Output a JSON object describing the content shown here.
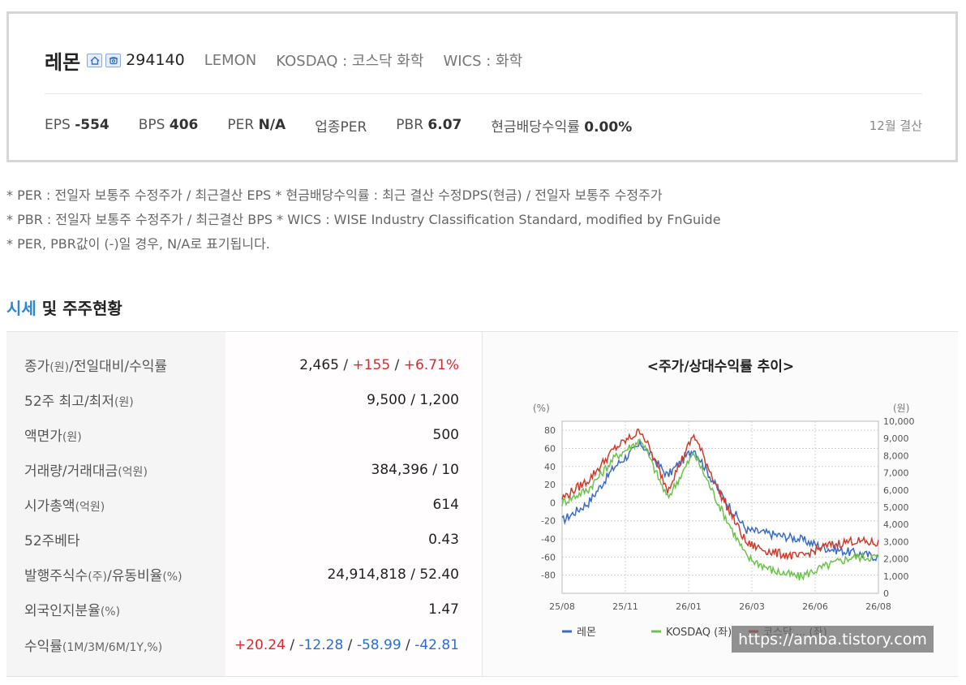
{
  "company": {
    "name": "레몬",
    "code": "294140",
    "english_name": "LEMON",
    "market": "KOSDAQ : 코스닥 화학",
    "wics": "WICS : 화학",
    "icons": [
      "home-icon",
      "phone-icon"
    ]
  },
  "metrics": {
    "eps_label": "EPS",
    "eps_value": "-554",
    "bps_label": "BPS",
    "bps_value": "406",
    "per_label": "PER",
    "per_value": "N/A",
    "industry_per_label": "업종PER",
    "pbr_label": "PBR",
    "pbr_value": "6.07",
    "dividend_label": "현금배당수익률",
    "dividend_value": "0.00%",
    "settlement": "12월 결산"
  },
  "notes": [
    "* PER : 전일자 보통주 수정주가 / 최근결산 EPS * 현금배당수익률 : 최근 결산 수정DPS(현금) / 전일자 보통주 수정주가",
    "* PBR : 전일자 보통주 수정주가 / 최근결산 BPS * WICS : WISE Industry Classification Standard, modified by FnGuide",
    "* PER, PBR값이 (-)일 경우, N/A로 표기됩니다."
  ],
  "section": {
    "title_highlight": "시세",
    "title_rest": " 및 주주현황"
  },
  "info_rows": [
    {
      "label": "종가",
      "label_small": "(원)",
      "label_tail": "/전일대비/수익률",
      "label_tail_small": ""
    },
    {
      "label": "52주 최고/최저",
      "label_small": "(원)",
      "label_tail": "",
      "label_tail_small": ""
    },
    {
      "label": "액면가",
      "label_small": "(원)",
      "label_tail": "",
      "label_tail_small": ""
    },
    {
      "label": "거래량/거래대금",
      "label_small": "(억원)",
      "label_tail": "",
      "label_tail_small": ""
    },
    {
      "label": "시가총액",
      "label_small": "(억원)",
      "label_tail": "",
      "label_tail_small": ""
    },
    {
      "label": "52주베타",
      "label_small": "",
      "label_tail": "",
      "label_tail_small": ""
    },
    {
      "label": "발행주식수",
      "label_small": "(주)",
      "label_tail": "/유동비율",
      "label_tail_small": "(%)"
    },
    {
      "label": "외국인지분율",
      "label_small": "(%)",
      "label_tail": "",
      "label_tail_small": ""
    },
    {
      "label": "수익률",
      "label_small": "(1M/3M/6M/1Y,%)",
      "label_tail": "",
      "label_tail_small": ""
    }
  ],
  "values": {
    "close_price": "2,465",
    "change": "+155",
    "change_pct": "+6.71%",
    "high_low_52w": "9,500 / 1,200",
    "face_value": "500",
    "volume_amount": "384,396 / 10",
    "market_cap": "614",
    "beta_52w": "0.43",
    "shares_float": "24,914,818 / 52.40",
    "foreign_ratio": "1.47",
    "ret_1m": "+20.24",
    "ret_3m": "-12.28",
    "ret_6m": "-58.99",
    "ret_1y": "-42.81",
    "slash": " / "
  },
  "chart": {
    "title": "<주가/상대수익률 추이>",
    "left_unit": "(%)",
    "right_unit": "(원)",
    "left_ticks": [
      "80",
      "60",
      "40",
      "20",
      "0",
      "-20",
      "-40",
      "-60",
      "-80"
    ],
    "right_ticks": [
      "10,000",
      "9,000",
      "8,000",
      "7,000",
      "6,000",
      "5,000",
      "4,000",
      "3,000",
      "2,000",
      "1,000",
      "0"
    ],
    "x_ticks": [
      "25/08",
      "25/11",
      "26/01",
      "26/03",
      "26/06",
      "26/08"
    ],
    "legend": [
      {
        "name": "레몬",
        "color": "#3a6bc4"
      },
      {
        "name": "KOSDAQ (좌)",
        "color": "#6cc24a"
      },
      {
        "name": "코스닥 ... (좌)",
        "color": "#d23a2a"
      }
    ]
  },
  "chart_data": {
    "type": "line",
    "title": "<주가/상대수익률 추이>",
    "x": [
      "25/08",
      "25/09",
      "25/10",
      "25/11",
      "25/12",
      "26/01",
      "26/02",
      "26/03",
      "26/04",
      "26/05",
      "26/06",
      "26/07",
      "26/08"
    ],
    "y_left_range": [
      -80,
      80
    ],
    "y_right_range": [
      0,
      10000
    ],
    "grid": true,
    "legend_position": "bottom",
    "series": [
      {
        "name": "레몬",
        "color": "#3a6bc4",
        "values": [
          -20,
          0,
          40,
          65,
          30,
          60,
          10,
          -30,
          -35,
          -40,
          -50,
          -55,
          -60
        ]
      },
      {
        "name": "KOSDAQ (좌)",
        "color": "#6cc24a",
        "values": [
          0,
          15,
          50,
          70,
          5,
          55,
          -5,
          -60,
          -75,
          -82,
          -70,
          -60,
          -60
        ]
      },
      {
        "name": "코스닥 ... (좌)",
        "color": "#d23a2a",
        "values": [
          5,
          25,
          60,
          80,
          15,
          75,
          10,
          -45,
          -55,
          -60,
          -48,
          -42,
          -45
        ]
      }
    ]
  },
  "watermark": "https://amba.tistory.com"
}
